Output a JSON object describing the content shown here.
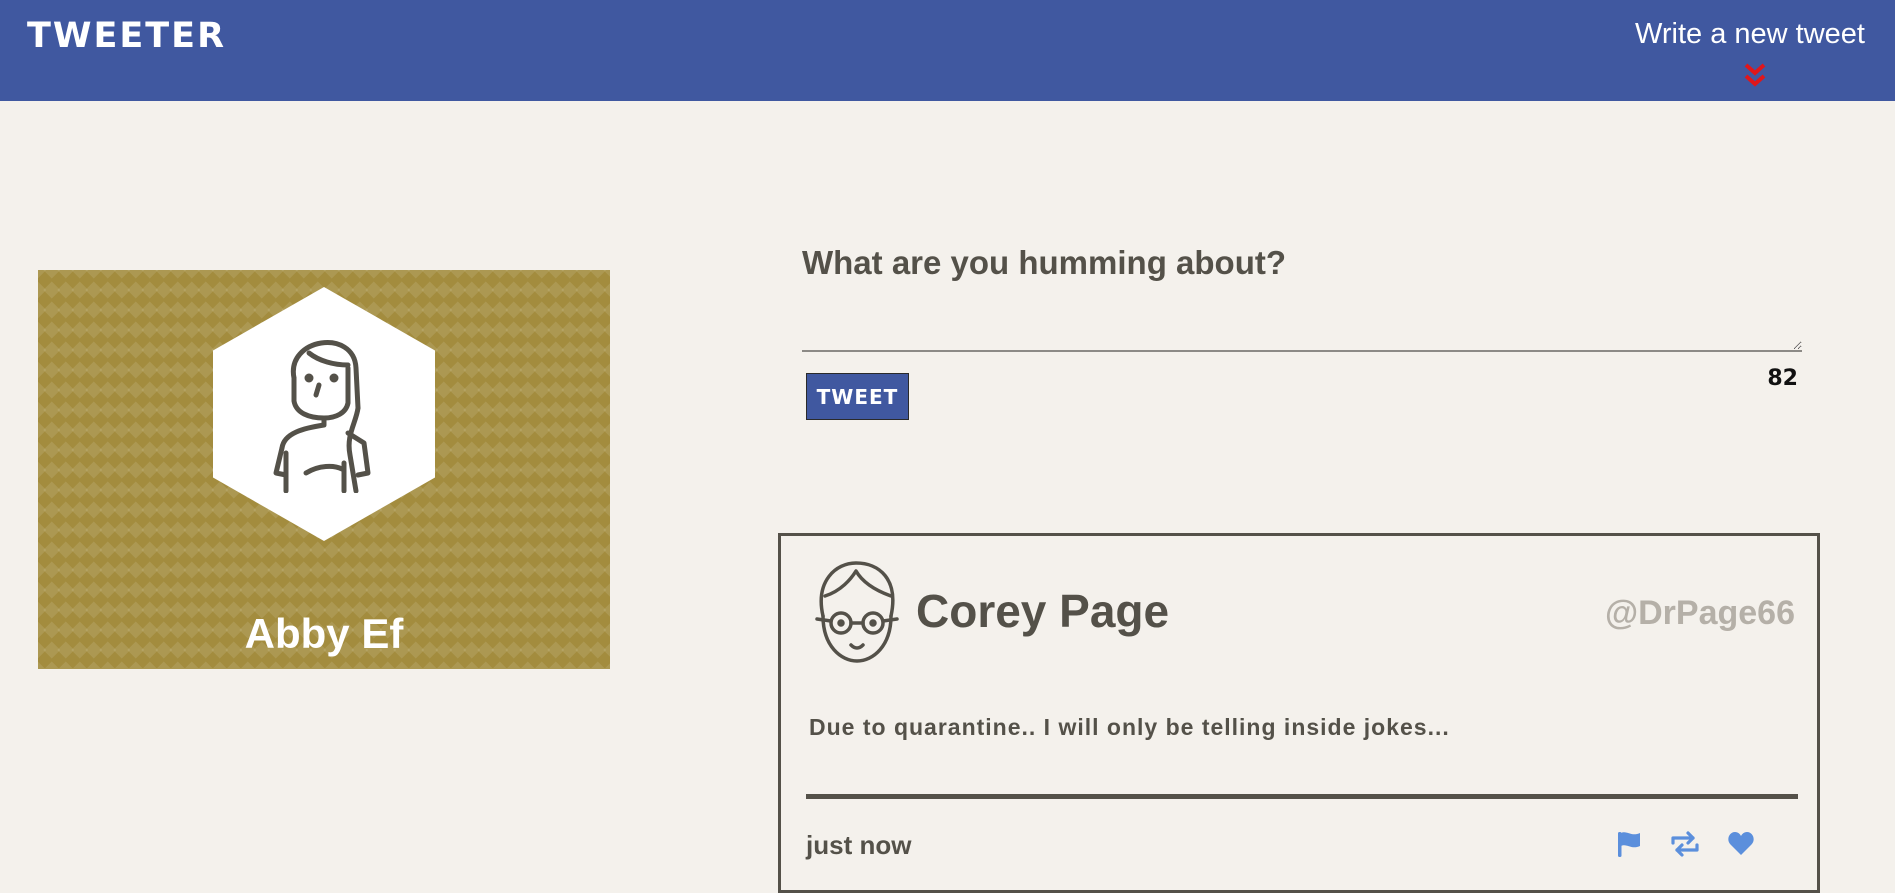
{
  "header": {
    "brand": "TWEETER",
    "write_link": "Write a new tweet",
    "write_icon": "double-chevron-down-icon",
    "colors": {
      "bar": "#4058a0",
      "chevron": "#e0161b"
    }
  },
  "profile": {
    "name": "Abby Ef",
    "avatar_icon": "woman-avatar-icon",
    "background_color": "#a38c3e"
  },
  "compose": {
    "prompt": "What are you humming about?",
    "input_value": "",
    "button_label": "TWEET",
    "char_counter": "82"
  },
  "tweet": {
    "author": "Corey Page",
    "handle": "@DrPage66",
    "avatar_icon": "man-with-glasses-avatar-icon",
    "body": "Due to quarantine.. I will only be telling inside jokes...",
    "time": "just now",
    "actions": [
      {
        "icon": "flag-icon"
      },
      {
        "icon": "retweet-icon"
      },
      {
        "icon": "heart-icon"
      }
    ],
    "action_color": "#5b8fdc"
  }
}
